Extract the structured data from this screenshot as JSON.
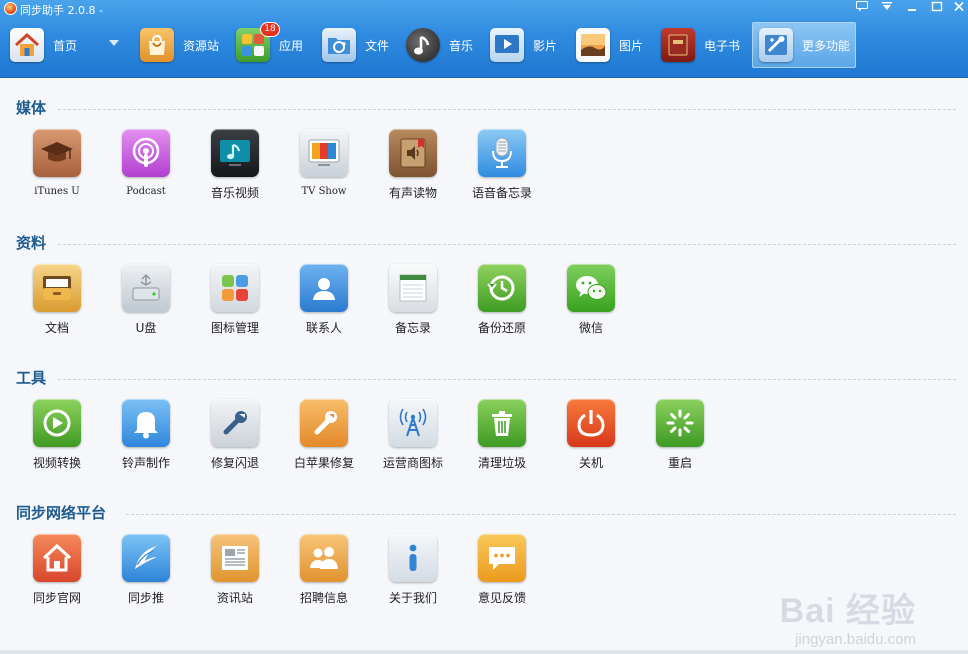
{
  "window": {
    "title": "同步助手 2.0.8 -",
    "controls": [
      "message-icon",
      "dropdown-icon",
      "minimize-icon",
      "maximize-icon",
      "close-icon"
    ]
  },
  "nav": {
    "items": [
      {
        "label": "首页",
        "icon": "home-icon"
      },
      {
        "label": "资源站",
        "icon": "shopping-bag-icon"
      },
      {
        "label": "应用",
        "icon": "apps-icon",
        "badge": "18"
      },
      {
        "label": "文件",
        "icon": "folder-sync-icon"
      },
      {
        "label": "音乐",
        "icon": "music-note-icon"
      },
      {
        "label": "影片",
        "icon": "play-video-icon"
      },
      {
        "label": "图片",
        "icon": "picture-icon"
      },
      {
        "label": "电子书",
        "icon": "book-icon"
      },
      {
        "label": "更多功能",
        "icon": "more-tools-icon",
        "active": true
      }
    ]
  },
  "sections": [
    {
      "title": "媒体",
      "tiles": [
        {
          "label": "iTunes U",
          "icon": "graduation-cap-icon"
        },
        {
          "label": "Podcast",
          "icon": "podcast-icon"
        },
        {
          "label": "音乐视频",
          "icon": "music-video-icon"
        },
        {
          "label": "TV Show",
          "icon": "tv-show-icon"
        },
        {
          "label": "有声读物",
          "icon": "audiobook-icon"
        },
        {
          "label": "语音备忘录",
          "icon": "microphone-icon"
        }
      ]
    },
    {
      "title": "资料",
      "tiles": [
        {
          "label": "文档",
          "icon": "document-drawer-icon"
        },
        {
          "label": "U盘",
          "icon": "usb-drive-icon"
        },
        {
          "label": "图标管理",
          "icon": "icon-grid-icon"
        },
        {
          "label": "联系人",
          "icon": "contacts-icon"
        },
        {
          "label": "备忘录",
          "icon": "notepad-icon"
        },
        {
          "label": "备份还原",
          "icon": "backup-restore-icon"
        },
        {
          "label": "微信",
          "icon": "wechat-icon"
        }
      ]
    },
    {
      "title": "工具",
      "tiles": [
        {
          "label": "视频转换",
          "icon": "video-convert-icon"
        },
        {
          "label": "铃声制作",
          "icon": "bell-icon"
        },
        {
          "label": "修复闪退",
          "icon": "wrench-icon"
        },
        {
          "label": "白苹果修复",
          "icon": "repair-tool-icon"
        },
        {
          "label": "运营商图标",
          "icon": "carrier-tower-icon"
        },
        {
          "label": "清理垃圾",
          "icon": "trash-icon"
        },
        {
          "label": "关机",
          "icon": "power-icon"
        },
        {
          "label": "重启",
          "icon": "restart-icon"
        }
      ]
    },
    {
      "title": "同步网络平台",
      "tiles": [
        {
          "label": "同步官网",
          "icon": "website-home-icon"
        },
        {
          "label": "同步推",
          "icon": "tongbu-push-icon"
        },
        {
          "label": "资讯站",
          "icon": "news-icon"
        },
        {
          "label": "招聘信息",
          "icon": "recruit-icon"
        },
        {
          "label": "关于我们",
          "icon": "info-icon"
        },
        {
          "label": "意见反馈",
          "icon": "feedback-icon"
        }
      ]
    }
  ],
  "watermark": {
    "text": "Bai 经验",
    "sub": "jingyan.baidu.com"
  }
}
